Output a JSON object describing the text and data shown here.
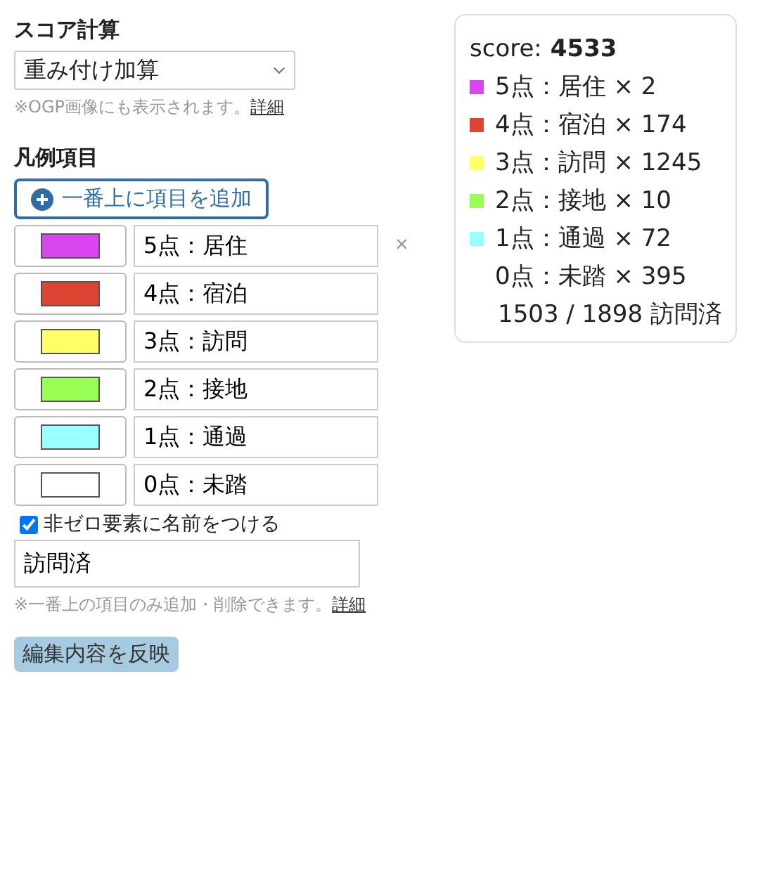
{
  "score_settings": {
    "title": "スコア計算",
    "method": "重み付け加算",
    "note": "※OGP画像にも表示されます。",
    "note_link": "詳細"
  },
  "legend": {
    "title": "凡例項目",
    "add_button": "一番上に項目を追加",
    "items": [
      {
        "color": "#d946ef",
        "label": "5点：居住",
        "remove_label": "×"
      },
      {
        "color": "#dc4433",
        "label": "4点：宿泊"
      },
      {
        "color": "#ffff66",
        "label": "3点：訪問"
      },
      {
        "color": "#99ff55",
        "label": "2点：接地"
      },
      {
        "color": "#99ffff",
        "label": "1点：通過"
      },
      {
        "color": "#ffffff",
        "label": "0点：未踏"
      }
    ],
    "name_option": {
      "label": "非ゼロ要素に名前をつける",
      "checked": true
    },
    "name_value": "訪問済",
    "note": "※一番上の項目のみ追加・削除できます。",
    "note_link": "詳細"
  },
  "apply_button": "編集内容を反映",
  "summary": {
    "score_label": "score:",
    "score_value": "4533",
    "items": [
      {
        "color": "#d946ef",
        "text": "5点：居住 × 2"
      },
      {
        "color": "#dc4433",
        "text": "4点：宿泊 × 174"
      },
      {
        "color": "#ffff66",
        "text": "3点：訪問 × 1245"
      },
      {
        "color": "#99ff55",
        "text": "2点：接地 × 10"
      },
      {
        "color": "#99ffff",
        "text": "1点：通過 × 72"
      },
      {
        "color": "#ffffff",
        "text": "0点：未踏 × 395"
      }
    ],
    "total": "1503 / 1898 訪問済"
  }
}
